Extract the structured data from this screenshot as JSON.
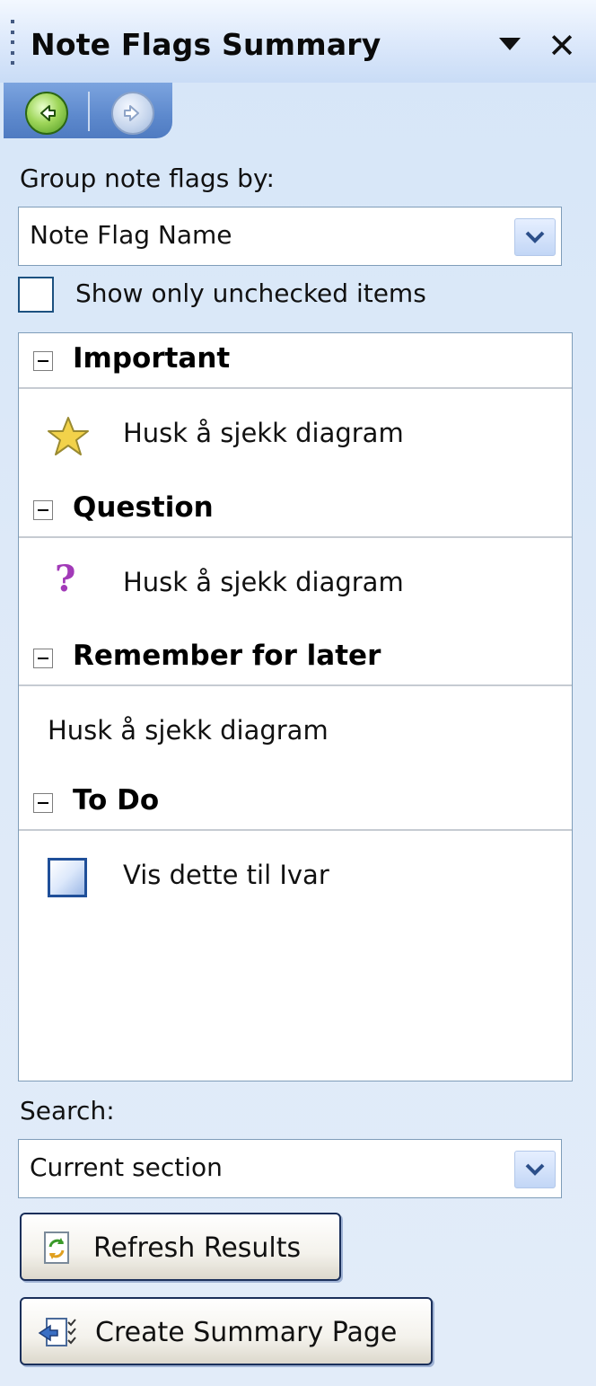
{
  "pane": {
    "title": "Note Flags Summary"
  },
  "group_by": {
    "label": "Group note flags by:",
    "selected": "Note Flag Name"
  },
  "show_unchecked": {
    "label": "Show only unchecked items",
    "checked": false
  },
  "groups": [
    {
      "name": "Important",
      "icon": "star-icon",
      "items": [
        "Husk å sjekk diagram"
      ]
    },
    {
      "name": "Question",
      "icon": "question-mark-icon",
      "items": [
        "Husk å sjekk diagram"
      ]
    },
    {
      "name": "Remember for later",
      "icon": "",
      "items": [
        "Husk å sjekk diagram"
      ]
    },
    {
      "name": "To Do",
      "icon": "todo-checkbox-icon",
      "items": [
        "Vis dette til Ivar"
      ]
    }
  ],
  "search": {
    "label": "Search:",
    "selected": "Current section"
  },
  "buttons": {
    "refresh": "Refresh Results",
    "create_summary": "Create Summary Page"
  },
  "colors": {
    "accent": "#5d89cd",
    "question_icon": "#a23ab8",
    "star_icon": "#f2d24a"
  }
}
